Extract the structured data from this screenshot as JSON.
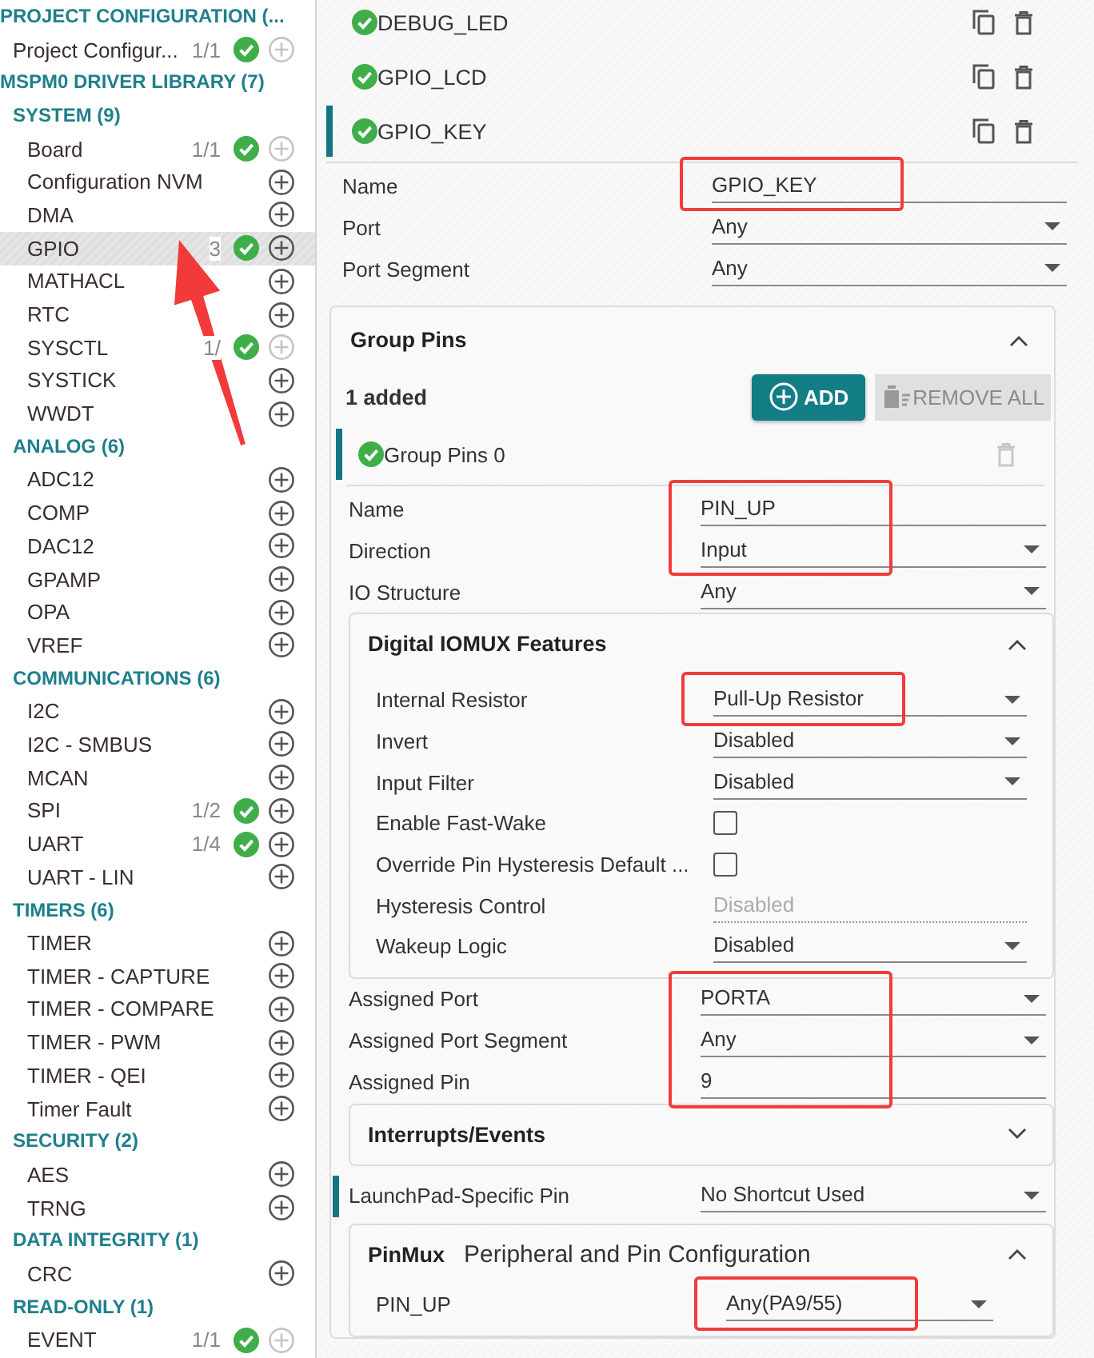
{
  "sidebar": {
    "groups": [
      {
        "title": "PROJECT CONFIGURATION (...",
        "items": [
          {
            "label": "Project Configur...",
            "count": "1/1",
            "configured": true,
            "add_enabled": false,
            "selected": false
          }
        ]
      },
      {
        "title": "MSPM0 DRIVER LIBRARY (7)",
        "children": [
          {
            "title": "SYSTEM (9)",
            "items": [
              {
                "label": "Board",
                "count": "1/1",
                "configured": true,
                "add_enabled": false,
                "selected": false
              },
              {
                "label": "Configuration NVM",
                "configured": false,
                "add_enabled": true,
                "selected": false
              },
              {
                "label": "DMA",
                "configured": false,
                "add_enabled": true,
                "selected": false
              },
              {
                "label": "GPIO",
                "count": "3",
                "configured": true,
                "add_enabled": true,
                "selected": true
              },
              {
                "label": "MATHACL",
                "configured": false,
                "add_enabled": true,
                "selected": false
              },
              {
                "label": "RTC",
                "configured": false,
                "add_enabled": true,
                "selected": false
              },
              {
                "label": "SYSCTL",
                "count": "1/",
                "configured": true,
                "add_enabled": false,
                "selected": false
              },
              {
                "label": "SYSTICK",
                "configured": false,
                "add_enabled": true,
                "selected": false
              },
              {
                "label": "WWDT",
                "configured": false,
                "add_enabled": true,
                "selected": false
              }
            ]
          },
          {
            "title": "ANALOG (6)",
            "items": [
              {
                "label": "ADC12",
                "configured": false,
                "add_enabled": true,
                "selected": false
              },
              {
                "label": "COMP",
                "configured": false,
                "add_enabled": true,
                "selected": false
              },
              {
                "label": "DAC12",
                "configured": false,
                "add_enabled": true,
                "selected": false
              },
              {
                "label": "GPAMP",
                "configured": false,
                "add_enabled": true,
                "selected": false
              },
              {
                "label": "OPA",
                "configured": false,
                "add_enabled": true,
                "selected": false
              },
              {
                "label": "VREF",
                "configured": false,
                "add_enabled": true,
                "selected": false
              }
            ]
          },
          {
            "title": "COMMUNICATIONS (6)",
            "items": [
              {
                "label": "I2C",
                "configured": false,
                "add_enabled": true,
                "selected": false
              },
              {
                "label": "I2C - SMBUS",
                "configured": false,
                "add_enabled": true,
                "selected": false
              },
              {
                "label": "MCAN",
                "configured": false,
                "add_enabled": true,
                "selected": false
              },
              {
                "label": "SPI",
                "count": "1/2",
                "configured": true,
                "add_enabled": true,
                "selected": false
              },
              {
                "label": "UART",
                "count": "1/4",
                "configured": true,
                "add_enabled": true,
                "selected": false
              },
              {
                "label": "UART - LIN",
                "configured": false,
                "add_enabled": true,
                "selected": false
              }
            ]
          },
          {
            "title": "TIMERS (6)",
            "items": [
              {
                "label": "TIMER",
                "configured": false,
                "add_enabled": true,
                "selected": false
              },
              {
                "label": "TIMER - CAPTURE",
                "configured": false,
                "add_enabled": true,
                "selected": false
              },
              {
                "label": "TIMER - COMPARE",
                "configured": false,
                "add_enabled": true,
                "selected": false
              },
              {
                "label": "TIMER - PWM",
                "configured": false,
                "add_enabled": true,
                "selected": false
              },
              {
                "label": "TIMER - QEI",
                "configured": false,
                "add_enabled": true,
                "selected": false
              },
              {
                "label": "Timer Fault",
                "configured": false,
                "add_enabled": true,
                "selected": false
              }
            ]
          },
          {
            "title": "SECURITY (2)",
            "items": [
              {
                "label": "AES",
                "configured": false,
                "add_enabled": true,
                "selected": false
              },
              {
                "label": "TRNG",
                "configured": false,
                "add_enabled": true,
                "selected": false
              }
            ]
          },
          {
            "title": "DATA INTEGRITY (1)",
            "items": [
              {
                "label": "CRC",
                "configured": false,
                "add_enabled": true,
                "selected": false
              }
            ]
          },
          {
            "title": "READ-ONLY (1)",
            "items": [
              {
                "label": "EVENT",
                "count": "1/1",
                "configured": true,
                "add_enabled": false,
                "selected": false
              }
            ]
          }
        ]
      }
    ]
  },
  "annotation_arrow": true,
  "instances": [
    {
      "name": "DEBUG_LED",
      "configured": true,
      "selected": false
    },
    {
      "name": "GPIO_LCD",
      "configured": true,
      "selected": false
    },
    {
      "name": "GPIO_KEY",
      "configured": true,
      "selected": true
    }
  ],
  "fields": [
    {
      "label": "Name",
      "kind": "text",
      "value": "GPIO_KEY",
      "marked": true
    },
    {
      "label": "Port",
      "kind": "select",
      "value": "Any",
      "marked": false
    },
    {
      "label": "Port Segment",
      "kind": "select",
      "value": "Any",
      "marked": false
    }
  ],
  "group_pins": {
    "title": "Group Pins",
    "expanded": true,
    "count_text": "1 added",
    "add_label": "ADD",
    "remove_label": "REMOVE ALL",
    "remove_enabled": false,
    "items": [
      {
        "name": "Group Pins 0",
        "configured": true,
        "selected": true
      }
    ],
    "fields": [
      {
        "label": "Name",
        "kind": "text",
        "value": "PIN_UP",
        "marked": true
      },
      {
        "label": "Direction",
        "kind": "select",
        "value": "Input",
        "marked": true
      },
      {
        "label": "IO Structure",
        "kind": "select",
        "value": "Any",
        "marked": false
      }
    ],
    "iomux": {
      "title": "Digital IOMUX Features",
      "expanded": true,
      "fields": [
        {
          "label": "Internal Resistor",
          "kind": "select",
          "value": "Pull-Up Resistor",
          "marked": true
        },
        {
          "label": "Invert",
          "kind": "select",
          "value": "Disabled",
          "marked": false
        },
        {
          "label": "Input Filter",
          "kind": "select",
          "value": "Disabled",
          "marked": false
        },
        {
          "label": "Enable Fast-Wake",
          "kind": "checkbox",
          "checked": false,
          "marked": false
        },
        {
          "label": "Override Pin Hysteresis Default ...",
          "kind": "checkbox",
          "checked": false,
          "marked": false
        },
        {
          "label": "Hysteresis Control",
          "kind": "readonly",
          "value": "Disabled",
          "marked": false
        },
        {
          "label": "Wakeup Logic",
          "kind": "select",
          "value": "Disabled",
          "marked": false
        }
      ]
    },
    "fields_after": [
      {
        "label": "Assigned Port",
        "kind": "select",
        "value": "PORTA",
        "marked": true
      },
      {
        "label": "Assigned Port Segment",
        "kind": "select",
        "value": "Any",
        "marked": true
      },
      {
        "label": "Assigned Pin",
        "kind": "text",
        "value": "9",
        "marked": true
      }
    ],
    "interrupts": {
      "title": "Interrupts/Events",
      "expanded": false
    },
    "launchpad_pin": {
      "label": "LaunchPad-Specific Pin",
      "kind": "select",
      "value": "No Shortcut Used",
      "marked": false
    },
    "pinmux": {
      "title": "PinMux",
      "subtitle": "Peripheral and Pin Configuration",
      "expanded": true,
      "fields": [
        {
          "label": "PIN_UP",
          "kind": "select",
          "value": "Any(PA9/55)",
          "marked": true
        }
      ]
    }
  }
}
